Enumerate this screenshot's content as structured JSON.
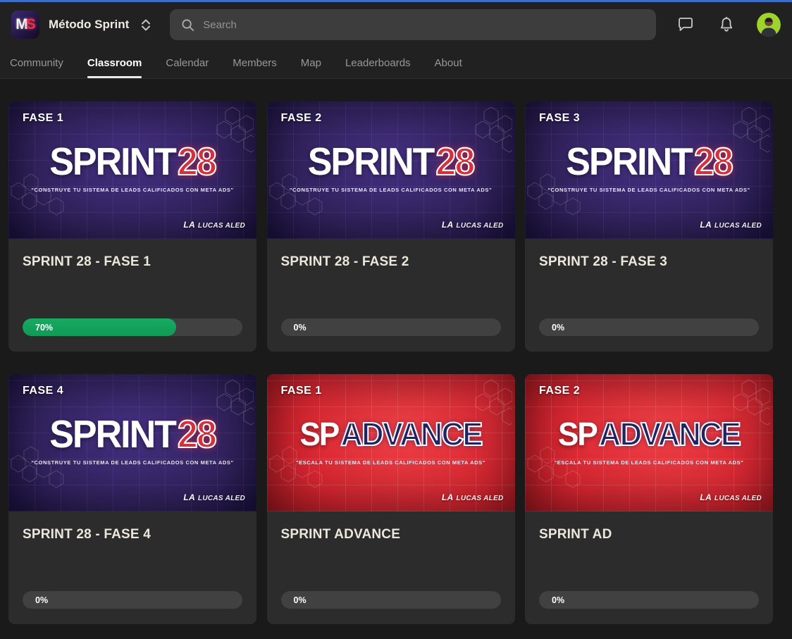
{
  "page": {
    "top_strip_color": "#3b6fc9"
  },
  "header": {
    "logo_m": "M",
    "logo_s": "S",
    "community_name": "Método Sprint",
    "search_placeholder": "Search"
  },
  "tabs": [
    {
      "label": "Community",
      "active": false
    },
    {
      "label": "Classroom",
      "active": true
    },
    {
      "label": "Calendar",
      "active": false
    },
    {
      "label": "Members",
      "active": false
    },
    {
      "label": "Map",
      "active": false
    },
    {
      "label": "Leaderboards",
      "active": false
    },
    {
      "label": "About",
      "active": false
    }
  ],
  "classroom": {
    "cards": [
      {
        "badge": "FASE 1",
        "cover_type": "sprint28",
        "cover": {
          "brand_primary": "SPRINT",
          "brand_accent": "28",
          "tagline": "\"CONSTRUYE TU SISTEMA DE LEADS CALIFICADOS CON META ADS\"",
          "logo_prefix": "LA",
          "logo_name": "LUCAS ALED"
        },
        "title": "SPRINT 28 - FASE 1",
        "progress_percent": 70,
        "progress_label": "70%"
      },
      {
        "badge": "FASE 2",
        "cover_type": "sprint28",
        "cover": {
          "brand_primary": "SPRINT",
          "brand_accent": "28",
          "tagline": "\"CONSTRUYE TU SISTEMA DE LEADS CALIFICADOS CON META ADS\"",
          "logo_prefix": "LA",
          "logo_name": "LUCAS ALED"
        },
        "title": "SPRINT 28 - FASE 2",
        "progress_percent": 0,
        "progress_label": "0%"
      },
      {
        "badge": "FASE 3",
        "cover_type": "sprint28",
        "cover": {
          "brand_primary": "SPRINT",
          "brand_accent": "28",
          "tagline": "\"CONSTRUYE TU SISTEMA DE LEADS CALIFICADOS CON META ADS\"",
          "logo_prefix": "LA",
          "logo_name": "LUCAS ALED"
        },
        "title": "SPRINT 28 - FASE 3",
        "progress_percent": 0,
        "progress_label": "0%"
      },
      {
        "badge": "FASE 4",
        "cover_type": "sprint28",
        "cover": {
          "brand_primary": "SPRINT",
          "brand_accent": "28",
          "tagline": "\"CONSTRUYE TU SISTEMA DE LEADS CALIFICADOS CON META ADS\"",
          "logo_prefix": "LA",
          "logo_name": "LUCAS ALED"
        },
        "title": "SPRINT 28 - FASE 4",
        "progress_percent": 0,
        "progress_label": "0%"
      },
      {
        "badge": "FASE 1",
        "cover_type": "advance",
        "cover": {
          "brand_primary": "SP",
          "brand_accent": "ADVANCE",
          "tagline": "\"ESCALA TU SISTEMA DE LEADS CALIFICADOS CON META ADS\"",
          "logo_prefix": "LA",
          "logo_name": "LUCAS ALED"
        },
        "title": "SPRINT ADVANCE",
        "progress_percent": 0,
        "progress_label": "0%"
      },
      {
        "badge": "FASE 2",
        "cover_type": "advance",
        "cover": {
          "brand_primary": "SP",
          "brand_accent": "ADVANCE",
          "tagline": "\"ESCALA TU SISTEMA DE LEADS CALIFICADOS CON META ADS\"",
          "logo_prefix": "LA",
          "logo_name": "LUCAS ALED"
        },
        "title": "SPRINT AD",
        "progress_percent": 0,
        "progress_label": "0%"
      }
    ]
  },
  "colors": {
    "progress_green": "#14a35c",
    "brand_red": "#d3313c",
    "brand_navy": "#232263",
    "avatar_green": "#9ed32c",
    "top_strip_blue": "#3b6fc9"
  }
}
